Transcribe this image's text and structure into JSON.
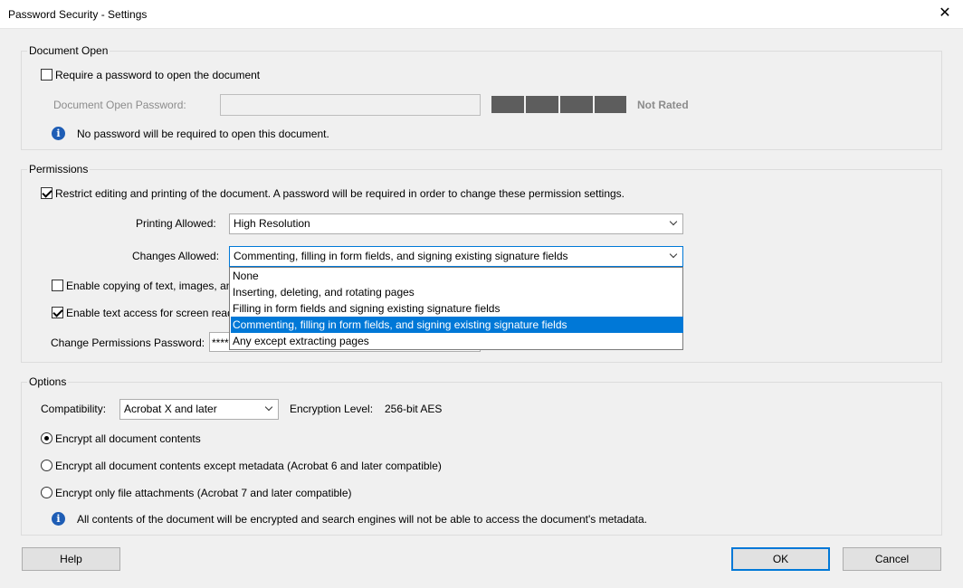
{
  "window": {
    "title": "Password Security - Settings",
    "close_glyph": "✕"
  },
  "document_open": {
    "group_label": "Document Open",
    "require_password_label": "Require a password to open the document",
    "require_password_checked": false,
    "password_label": "Document Open Password:",
    "password_value": "",
    "strength_label": "Not Rated",
    "info_text": "No password will be required to open this document."
  },
  "permissions": {
    "group_label": "Permissions",
    "restrict_label": "Restrict editing and printing of the document. A password will be required in order to change these permission settings.",
    "restrict_checked": true,
    "printing_label": "Printing Allowed:",
    "printing_value": "High Resolution",
    "changes_label": "Changes Allowed:",
    "changes_value": "Commenting, filling in form fields, and signing existing signature fields",
    "changes_options": [
      "None",
      "Inserting, deleting, and rotating pages",
      "Filling in form fields and signing existing signature fields",
      "Commenting, filling in form fields, and signing existing signature fields",
      "Any except extracting pages"
    ],
    "changes_selected_index": 3,
    "enable_copy_label": "Enable copying of text, images, an",
    "enable_copy_checked": false,
    "enable_screen_reader_label": "Enable text access for screen reade",
    "enable_screen_reader_checked": true,
    "change_pwd_label": "Change Permissions Password:",
    "change_pwd_value": "****"
  },
  "options": {
    "group_label": "Options",
    "compatibility_label": "Compatibility:",
    "compatibility_value": "Acrobat X and later",
    "encryption_label": "Encryption  Level:",
    "encryption_value": "256-bit AES",
    "radio_all": "Encrypt all document contents",
    "radio_except_metadata": "Encrypt all document contents except metadata (Acrobat 6 and later compatible)",
    "radio_attachments": "Encrypt only file attachments (Acrobat 7 and later compatible)",
    "selected_radio": "all",
    "info_text": "All contents of the document will be encrypted and search engines will not be able to access the document's metadata."
  },
  "buttons": {
    "help": "Help",
    "ok": "OK",
    "cancel": "Cancel"
  },
  "icons": {
    "info": "i"
  },
  "colors": {
    "accent": "#0078d7",
    "info_icon": "#1e5db5",
    "meter": "#5d5d5d"
  }
}
